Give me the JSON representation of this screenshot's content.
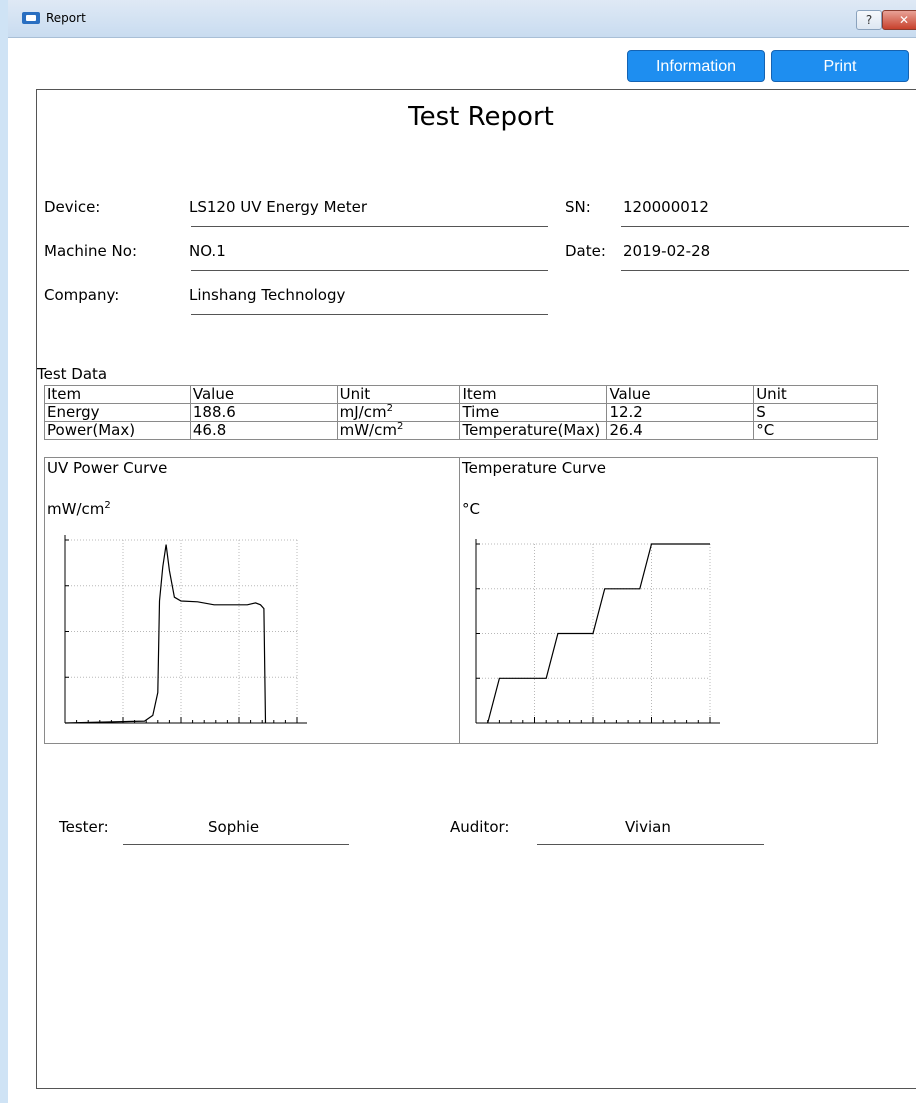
{
  "window": {
    "title": "Report",
    "help_label": "?",
    "close_label": "✕"
  },
  "toolbar": {
    "information_label": "Information",
    "print_label": "Print"
  },
  "report": {
    "title": "Test Report",
    "device_label": "Device:",
    "device_value": "LS120 UV Energy Meter",
    "sn_label": "SN:",
    "sn_value": "120000012",
    "machine_label": "Machine No:",
    "machine_value": "NO.1",
    "date_label": "Date:",
    "date_value": "2019-02-28",
    "company_label": "Company:",
    "company_value": "Linshang Technology",
    "test_data_label": "Test Data",
    "table": {
      "headers": [
        "Item",
        "Value",
        "Unit",
        "Item",
        "Value",
        "Unit"
      ],
      "row1": [
        "Energy",
        "188.6",
        "mJ/cm",
        "Time",
        "12.2",
        "S"
      ],
      "row2": [
        "Power(Max)",
        "46.8",
        "mW/cm",
        "Temperature(Max)",
        "26.4",
        "°C"
      ],
      "sup": "2"
    },
    "uv_curve": {
      "title": "UV Power Curve",
      "unit": "mW/cm",
      "unit_sup": "2"
    },
    "temp_curve": {
      "title": "Temperature Curve",
      "unit": "°C"
    },
    "tester_label": "Tester:",
    "tester_value": "Sophie",
    "auditor_label": "Auditor:",
    "auditor_value": "Vivian"
  },
  "chart_data": [
    {
      "type": "line",
      "title": "UV Power Curve",
      "ylabel": "mW/cm²",
      "series": [
        {
          "values": [
            [
              0,
              0
            ],
            [
              4.8,
              0.5
            ],
            [
              5.3,
              2
            ],
            [
              5.6,
              8
            ],
            [
              5.7,
              32
            ],
            [
              5.9,
              41
            ],
            [
              6.1,
              46.8
            ],
            [
              6.3,
              40
            ],
            [
              6.6,
              33
            ],
            [
              7,
              32
            ],
            [
              8,
              31.8
            ],
            [
              9,
              31
            ],
            [
              10,
              31
            ],
            [
              11,
              31
            ],
            [
              11.5,
              31.5
            ],
            [
              11.8,
              31
            ],
            [
              12,
              30
            ],
            [
              12.1,
              0
            ]
          ]
        }
      ]
    },
    {
      "type": "line",
      "title": "Temperature Curve",
      "ylabel": "°C",
      "series": [
        {
          "values": [
            [
              0.5,
              0
            ],
            [
              1,
              1
            ],
            [
              3,
              1
            ],
            [
              3.5,
              2
            ],
            [
              5,
              2
            ],
            [
              5.5,
              3
            ],
            [
              7,
              3
            ],
            [
              7.5,
              4
            ],
            [
              10,
              4
            ]
          ]
        }
      ]
    }
  ]
}
